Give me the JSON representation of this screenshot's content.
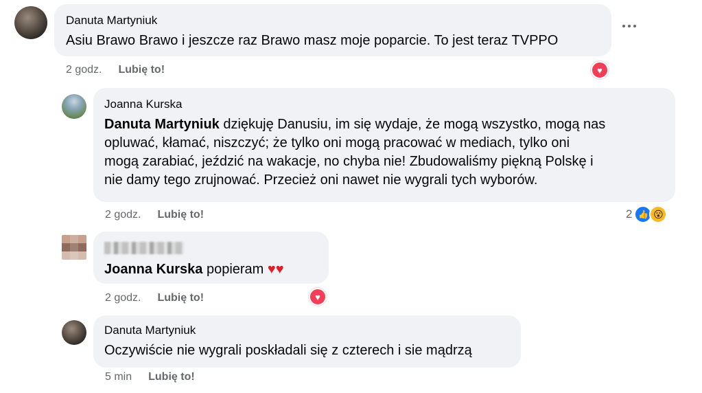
{
  "comments": [
    {
      "author": "Danuta Martyniuk",
      "text": "Asiu Brawo Brawo i jeszcze raz Brawo masz moje poparcie. To jest teraz TVPPO",
      "time": "2 godz.",
      "like_label": "Lubię to!",
      "reactions": [
        "heart"
      ]
    },
    {
      "author": "Joanna Kurska",
      "mention": "Danuta Martyniuk",
      "text_line1": " dziękuję Danusiu, im się wydaje, że mogą wszystko, mogą nas",
      "text_line2": "opluwać, kłamać, niszczyć; że tylko oni mogą pracować w mediach, tylko oni",
      "text_line3": "mogą zarabiać, jeździć na wakacje, no chyba nie! Zbudowaliśmy piękną Polskę i",
      "text_line4": "nie damy tego zrujnować. Przecież oni nawet nie wygrali tych wyborów.",
      "time": "2 godz.",
      "like_label": "Lubię to!",
      "reaction_count": "2",
      "reactions": [
        "like",
        "wow"
      ]
    },
    {
      "author_blurred": true,
      "mention": "Joanna Kurska",
      "text": " popieram ",
      "emoji": "♥♥",
      "time": "2 godz.",
      "like_label": "Lubię to!",
      "reactions": [
        "heart"
      ]
    },
    {
      "author": "Danuta Martyniuk",
      "text": "Oczywiście nie wygrali poskładali się z czterech i sie mądrzą",
      "time": "5 min",
      "like_label": "Lubię to!"
    }
  ],
  "icons": {
    "heart": "♥",
    "like": "👍",
    "wow": "😮",
    "more": "more-options-icon"
  },
  "colors": {
    "bubble": "#f0f2f5",
    "heart_reaction": "#f33e58",
    "like_reaction": "#1877f2",
    "wow_reaction": "#f7b928",
    "meta_text": "#65676b"
  }
}
